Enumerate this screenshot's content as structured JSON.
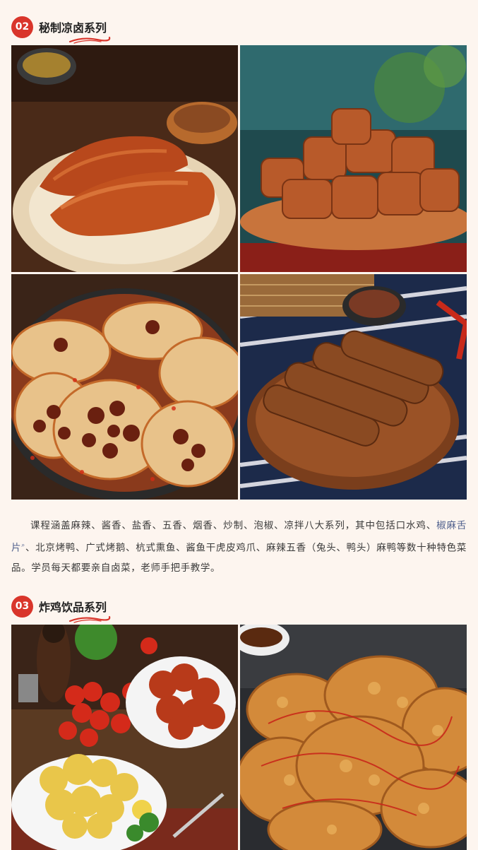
{
  "sections": [
    {
      "number": "02",
      "title": "秘制凉卤系列",
      "images": [
        "braised-pig-trotters",
        "braised-tofu-rolls",
        "spicy-lotus-root-slices",
        "braised-duck-necks"
      ]
    },
    {
      "number": "03",
      "title": "炸鸡饮品系列",
      "images": [
        "glazed-fried-chicken-platter",
        "crispy-fried-chicken-pile"
      ]
    }
  ],
  "paragraph": {
    "part1": "课程涵盖麻辣、酱香、盐香、五香、烟香、炒制、泡椒、凉拌八大系列，其中包括口水鸡、",
    "link": "椒麻舌片",
    "part2": "、北京烤鸭、广式烤鹅、杭式熏鱼、酱鱼干虎皮鸡爪、麻辣五香（兔头、鸭头）麻鸭等数十种特色菜品。学员每天都要亲自卤菜，老师手把手教学。"
  },
  "colors": {
    "accent": "#d9352b",
    "background": "#fdf5ef",
    "link": "#4e5f8c"
  }
}
